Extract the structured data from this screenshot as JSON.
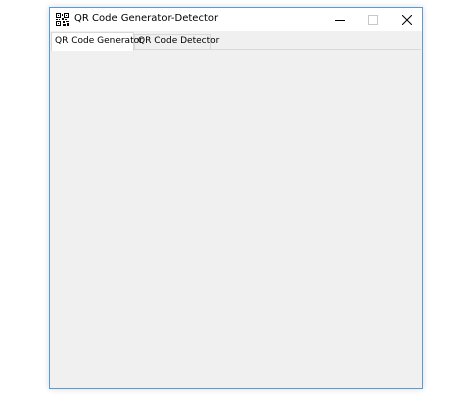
{
  "window": {
    "title": "QR Code Generator-Detector",
    "icon": "qr-code-icon",
    "controls": {
      "minimize_icon": "minimize-icon",
      "maximize_icon": "maximize-icon",
      "close_icon": "close-icon"
    }
  },
  "tabs": [
    {
      "label": "QR Code Generator",
      "active": true
    },
    {
      "label": "QR Code Detector",
      "active": false
    }
  ],
  "colors": {
    "window_border": "#5b9bd5",
    "panel_background": "#f0f0f0",
    "titlebar_background": "#ffffff"
  }
}
